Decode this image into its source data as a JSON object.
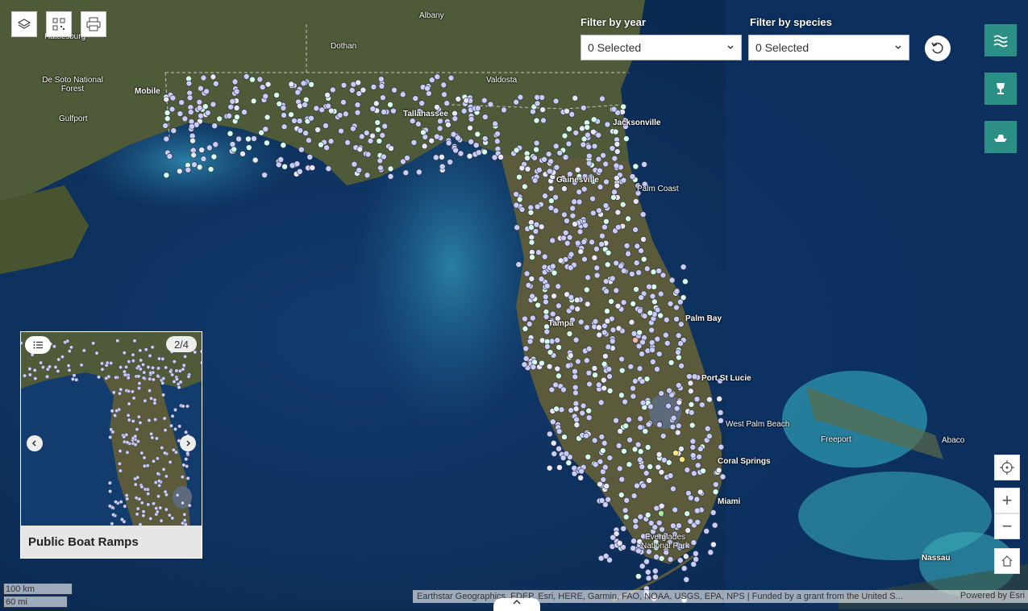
{
  "map": {
    "labels": [
      {
        "text": "Albany",
        "type": "town"
      },
      {
        "text": "Hattiesburg",
        "type": "town"
      },
      {
        "text": "Dothan",
        "type": "town"
      },
      {
        "text": "De Soto National Forest",
        "type": "town"
      },
      {
        "text": "Mobile",
        "type": "city"
      },
      {
        "text": "Gulfport",
        "type": "town"
      },
      {
        "text": "Valdosta",
        "type": "town"
      },
      {
        "text": "Jacksonville",
        "type": "city"
      },
      {
        "text": "Palm Coast",
        "type": "town"
      },
      {
        "text": "Palm Bay",
        "type": "city"
      },
      {
        "text": "Port St Lucie",
        "type": "city"
      },
      {
        "text": "West Palm Beach",
        "type": "town"
      },
      {
        "text": "Coral Springs",
        "type": "city"
      },
      {
        "text": "Miami",
        "type": "city"
      },
      {
        "text": "Everglades National Park",
        "type": "town"
      },
      {
        "text": "Freeport",
        "type": "town"
      },
      {
        "text": "Abaco",
        "type": "town"
      },
      {
        "text": "Nassau",
        "type": "city"
      },
      {
        "text": "Tallahassee",
        "type": "city"
      },
      {
        "text": "Gainesville",
        "type": "city"
      },
      {
        "text": "Tampa",
        "type": "city"
      }
    ],
    "point_color": "#c8ccff",
    "water_color": "#1a4b7a",
    "land_color": "#4a5a3a"
  },
  "toolbar": {
    "layers_icon": "layers-icon",
    "qr_icon": "qr-code-icon",
    "print_icon": "print-icon"
  },
  "filters": {
    "year_label": "Filter by year",
    "year_value": "0 Selected",
    "species_label": "Filter by species",
    "species_value": "0 Selected",
    "reset_icon": "reset-icon"
  },
  "side_buttons": [
    {
      "icon": "waves-icon"
    },
    {
      "icon": "trophy-icon"
    },
    {
      "icon": "boat-icon"
    }
  ],
  "card": {
    "counter": "2/4",
    "title": "Public Boat Ramps",
    "list_icon": "list-icon",
    "prev_icon": "chevron-left-icon",
    "next_icon": "chevron-right-icon"
  },
  "scale": {
    "km": "100 km",
    "mi": "60 mi"
  },
  "attribution": {
    "text": "Earthstar Geographics, FDEP, Esri, HERE, Garmin, FAO, NOAA, USGS, EPA, NPS | Funded by a grant from the United S...",
    "powered": "Powered by Esri"
  },
  "controls": {
    "locate_icon": "locate-icon",
    "zoom_in": "+",
    "zoom_out": "−",
    "home_icon": "home-icon"
  }
}
